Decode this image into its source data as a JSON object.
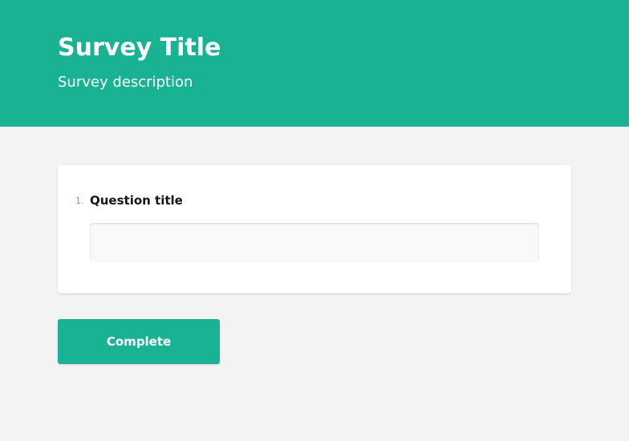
{
  "theme": {
    "accent": "#19b394",
    "background": "#f3f3f3",
    "card": "#ffffff"
  },
  "header": {
    "title": "Survey Title",
    "description": "Survey description"
  },
  "question": {
    "number": "1.",
    "title": "Question title",
    "value": "",
    "placeholder": ""
  },
  "footer": {
    "complete_label": "Complete"
  }
}
